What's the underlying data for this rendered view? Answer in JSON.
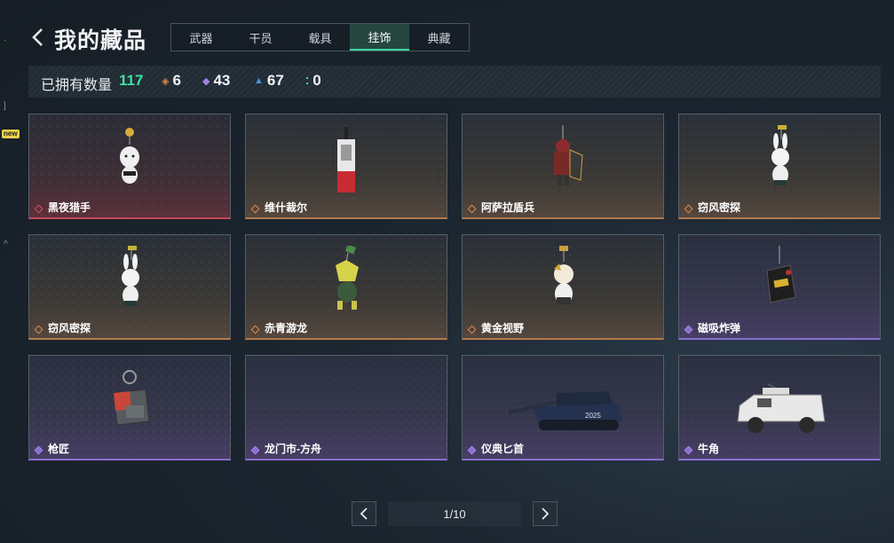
{
  "header": {
    "title": "我的藏品"
  },
  "tabs": [
    {
      "label": "武器",
      "active": false
    },
    {
      "label": "干员",
      "active": false
    },
    {
      "label": "载具",
      "active": false
    },
    {
      "label": "挂饰",
      "active": true
    },
    {
      "label": "典藏",
      "active": false
    }
  ],
  "stats": {
    "owned_label": "已拥有数量",
    "owned_total": "117",
    "orange_count": "6",
    "purple_count": "43",
    "blue_count": "67",
    "green_count": "0"
  },
  "sidebar": {
    "new_badge": "new"
  },
  "items": [
    {
      "name": "黑夜猎手",
      "rarity": "red"
    },
    {
      "name": "维什裁尔",
      "rarity": "orange"
    },
    {
      "name": "阿萨拉盾兵",
      "rarity": "orange"
    },
    {
      "name": "窃风密探",
      "rarity": "orange"
    },
    {
      "name": "窃风密探",
      "rarity": "orange"
    },
    {
      "name": "赤青游龙",
      "rarity": "orange"
    },
    {
      "name": "黄金视野",
      "rarity": "orange"
    },
    {
      "name": "磁吸炸弹",
      "rarity": "purple"
    },
    {
      "name": "枪匠",
      "rarity": "purple"
    },
    {
      "name": "龙门市-方舟",
      "rarity": "purple"
    },
    {
      "name": "仪典匕首",
      "rarity": "purple"
    },
    {
      "name": "牛角",
      "rarity": "purple"
    }
  ],
  "pagination": {
    "indicator": "1/10"
  },
  "colors": {
    "accent_green": "#3fe0a0",
    "orange": "#e0884a",
    "purple": "#8a6fd0",
    "red": "#e0495e"
  }
}
